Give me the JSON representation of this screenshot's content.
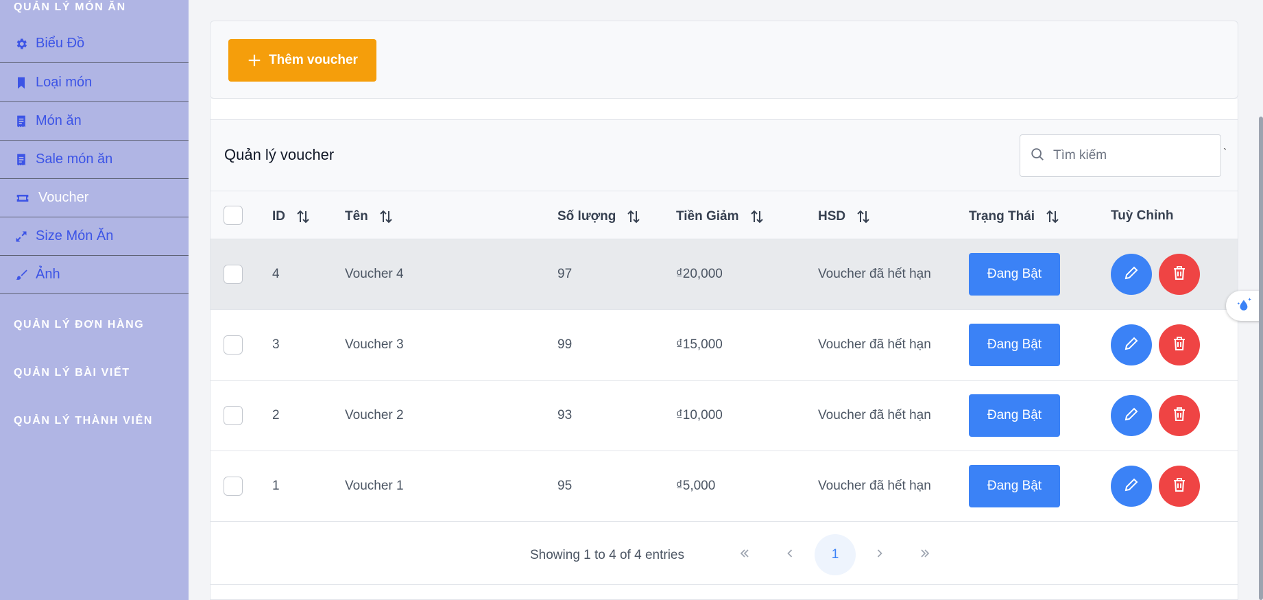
{
  "sidebar": {
    "section_food": "QUẢN LÝ MÓN ĂN",
    "items": [
      {
        "label": "Biểu Đồ",
        "icon": "gear-icon"
      },
      {
        "label": "Loại món",
        "icon": "bookmark-icon"
      },
      {
        "label": "Món ăn",
        "icon": "receipt-icon"
      },
      {
        "label": "Sale món ăn",
        "icon": "receipt-icon"
      },
      {
        "label": "Voucher",
        "icon": "ticket-icon"
      },
      {
        "label": "Size Món Ăn",
        "icon": "expand-icon"
      },
      {
        "label": "Ảnh",
        "icon": "brush-icon"
      }
    ],
    "section_orders": "QUẢN LÝ ĐƠN HÀNG",
    "section_posts": "QUẢN LÝ BÀI VIẾT",
    "section_members": "QUẢN LÝ THÀNH VIÊN"
  },
  "toolbar": {
    "add_label": "Thêm voucher"
  },
  "table": {
    "title": "Quản lý voucher",
    "search_placeholder": "Tìm kiếm",
    "columns": {
      "id": "ID",
      "name": "Tên",
      "quantity": "Số lượng",
      "discount": "Tiền Giảm",
      "expiry": "HSD",
      "status": "Trạng Thái",
      "actions": "Tuỳ Chỉnh"
    },
    "rows": [
      {
        "id": "4",
        "name": "Voucher 4",
        "quantity": "97",
        "discount": "₫20,000",
        "expiry": "Voucher đã hết hạn",
        "status": "Đang Bật"
      },
      {
        "id": "3",
        "name": "Voucher 3",
        "quantity": "99",
        "discount": "₫15,000",
        "expiry": "Voucher đã hết hạn",
        "status": "Đang Bật"
      },
      {
        "id": "2",
        "name": "Voucher 2",
        "quantity": "93",
        "discount": "₫10,000",
        "expiry": "Voucher đã hết hạn",
        "status": "Đang Bật"
      },
      {
        "id": "1",
        "name": "Voucher 1",
        "quantity": "95",
        "discount": "₫5,000",
        "expiry": "Voucher đã hết hạn",
        "status": "Đang Bật"
      }
    ]
  },
  "pagination": {
    "summary": "Showing 1 to 4 of 4 entries",
    "current_page": "1"
  },
  "colors": {
    "sidebar_bg": "#b0b5e4",
    "sidebar_text": "#3c54e6",
    "add_button": "#f59e0b",
    "status_button": "#3b82f6",
    "edit_button": "#3b82f6",
    "delete_button": "#ef4444"
  }
}
